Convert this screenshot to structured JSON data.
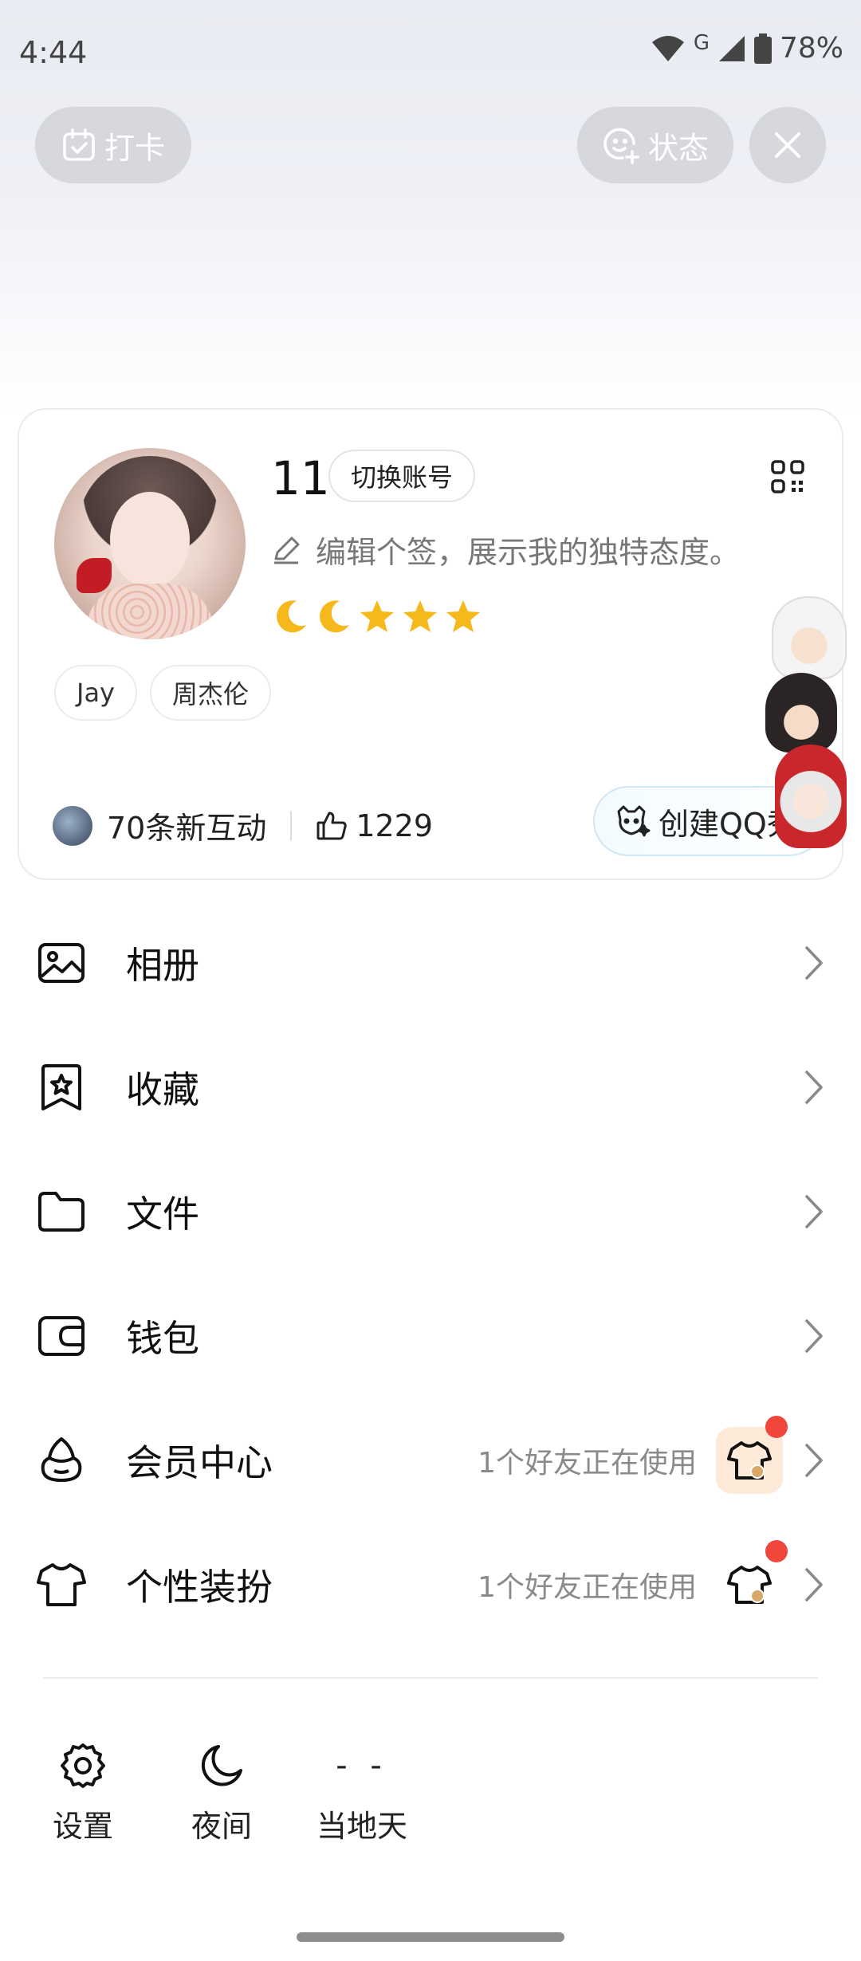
{
  "status_bar": {
    "time": "4:44",
    "network": "G",
    "battery": "78%"
  },
  "top_buttons": {
    "checkin_label": "打卡",
    "status_label": "状态"
  },
  "profile": {
    "nickname": "11",
    "switch_account_label": "切换账号",
    "signature": "编辑个签，展示我的独特态度。",
    "level_icons": [
      "moon",
      "moon",
      "star",
      "star",
      "star"
    ],
    "tags": [
      "Jay",
      "周杰伦"
    ],
    "interactions": "70条新互动",
    "likes": "1229",
    "create_qq_show": "创建QQ秀"
  },
  "menu": {
    "items": [
      {
        "label": "相册",
        "icon": "photo-album-icon",
        "sub": ""
      },
      {
        "label": "收藏",
        "icon": "bookmark-star-icon",
        "sub": ""
      },
      {
        "label": "文件",
        "icon": "folder-icon",
        "sub": ""
      },
      {
        "label": "钱包",
        "icon": "wallet-icon",
        "sub": ""
      },
      {
        "label": "会员中心",
        "icon": "vip-icon",
        "sub": "1个好友正在使用"
      },
      {
        "label": "个性装扮",
        "icon": "tshirt-icon",
        "sub": "1个好友正在使用"
      }
    ]
  },
  "bottom_bar": {
    "settings_label": "设置",
    "night_label": "夜间",
    "weather_value": "- -",
    "weather_label": "当地天"
  },
  "colors": {
    "accent_red": "#f0463c",
    "pill_bg": "#d6d8de",
    "vip_badge_bg": "#fde9d8"
  }
}
